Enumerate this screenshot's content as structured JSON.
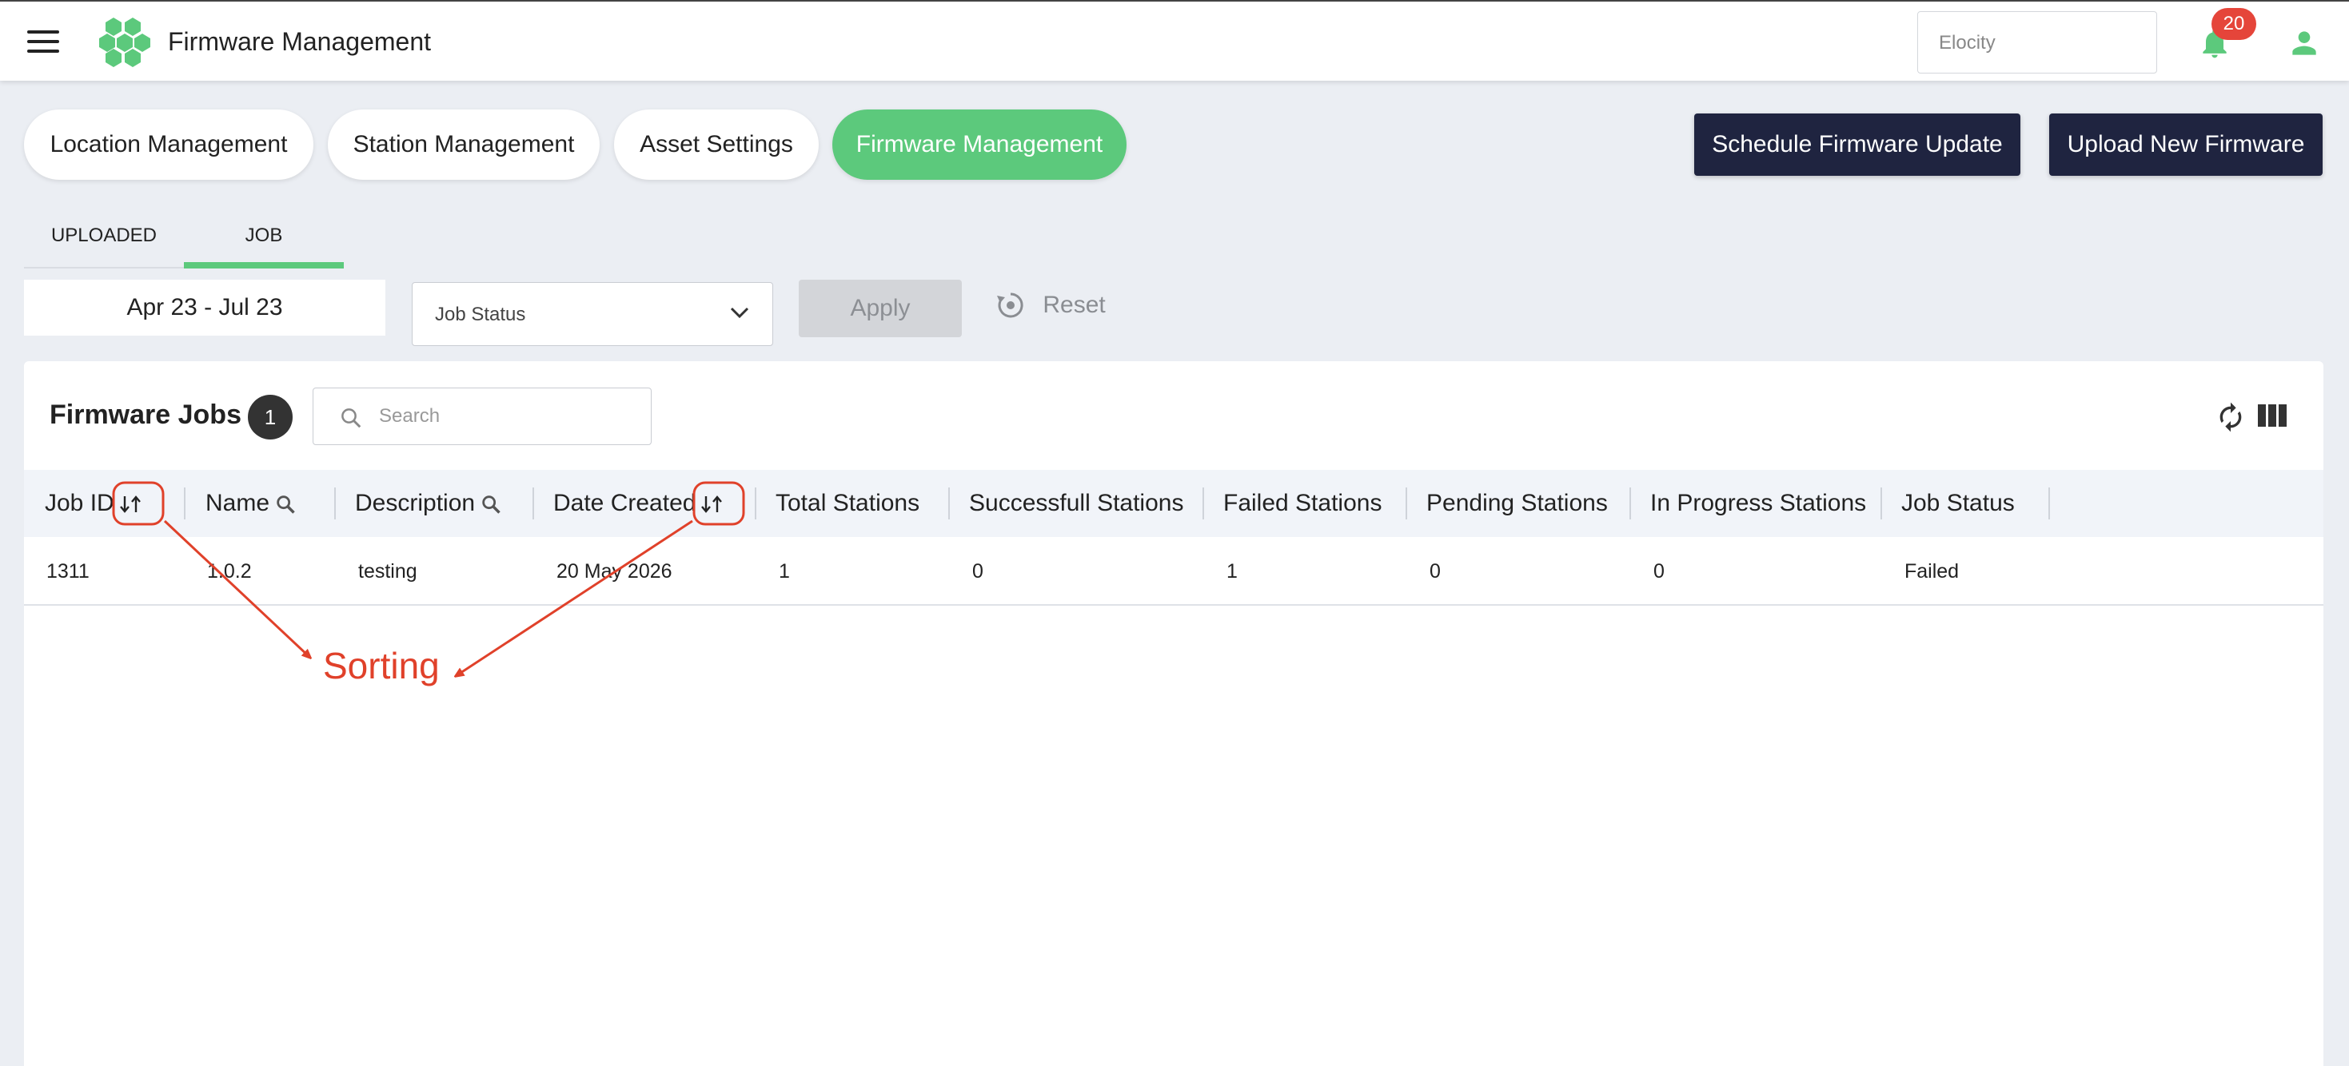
{
  "header": {
    "title": "Firmware Management",
    "tenant_placeholder": "Elocity",
    "notification_count": "20"
  },
  "nav_pills": [
    {
      "label": "Location Management",
      "active": false
    },
    {
      "label": "Station Management",
      "active": false
    },
    {
      "label": "Asset Settings",
      "active": false
    },
    {
      "label": "Firmware Management",
      "active": true
    }
  ],
  "actions": {
    "schedule_label": "Schedule Firmware Update",
    "upload_label": "Upload New Firmware"
  },
  "subtabs": {
    "uploaded": "UPLOADED",
    "job": "JOB",
    "active": "JOB"
  },
  "filters": {
    "date_range": "Apr 23 - Jul 23",
    "job_status_placeholder": "Job Status",
    "apply_label": "Apply",
    "reset_label": "Reset"
  },
  "card": {
    "title": "Firmware Jobs",
    "count": "1",
    "search_placeholder": "Search"
  },
  "table": {
    "columns": [
      "Job ID",
      "Name",
      "Description",
      "Date Created",
      "Total Stations",
      "Successfull Stations",
      "Failed Stations",
      "Pending Stations",
      "In Progress Stations",
      "Job Status"
    ],
    "rows": [
      [
        "1311",
        "1.0.2",
        "testing",
        "20 May 2026",
        "1",
        "0",
        "1",
        "0",
        "0",
        "Failed"
      ]
    ]
  },
  "annotation": {
    "label": "Sorting"
  },
  "colors": {
    "accent_green": "#5cc97c",
    "dark_button": "#1f2440",
    "badge_red": "#e5453a",
    "annotation_red": "#e0412a"
  }
}
